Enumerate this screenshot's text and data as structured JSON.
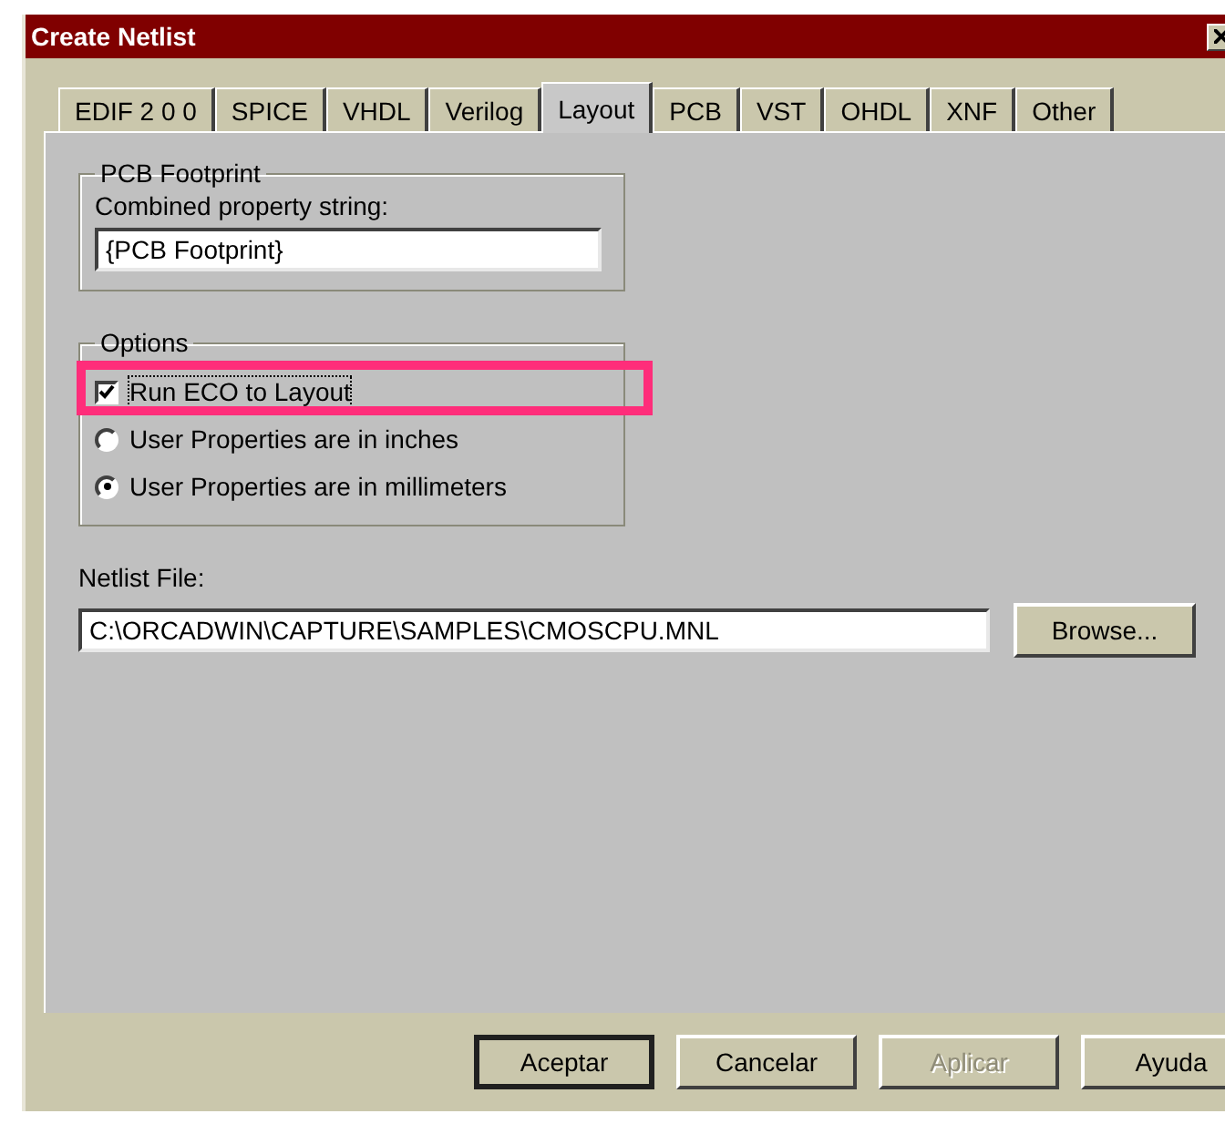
{
  "window": {
    "title": "Create Netlist"
  },
  "tabs": [
    {
      "label": "EDIF 2 0 0",
      "selected": false
    },
    {
      "label": "SPICE",
      "selected": false
    },
    {
      "label": "VHDL",
      "selected": false
    },
    {
      "label": "Verilog",
      "selected": false
    },
    {
      "label": "Layout",
      "selected": true
    },
    {
      "label": "PCB",
      "selected": false
    },
    {
      "label": "VST",
      "selected": false
    },
    {
      "label": "OHDL",
      "selected": false
    },
    {
      "label": "XNF",
      "selected": false
    },
    {
      "label": "Other",
      "selected": false
    }
  ],
  "pcb_footprint": {
    "legend": "PCB Footprint",
    "label": "Combined property string:",
    "value": "{PCB Footprint}"
  },
  "options": {
    "legend": "Options",
    "items": [
      {
        "kind": "checkbox",
        "label": "Run ECO to Layout",
        "checked": true,
        "highlighted": true
      },
      {
        "kind": "radio",
        "label": "User Properties are in inches",
        "selected": false,
        "highlighted": false
      },
      {
        "kind": "radio",
        "label": "User Properties are in millimeters",
        "selected": true,
        "highlighted": false
      }
    ]
  },
  "netlist_file": {
    "label": "Netlist File:",
    "value": "C:\\ORCADWIN\\CAPTURE\\SAMPLES\\CMOSCPU.MNL",
    "browse": "Browse..."
  },
  "buttons": [
    {
      "label": "Aceptar",
      "default": true,
      "disabled": false
    },
    {
      "label": "Cancelar",
      "default": false,
      "disabled": false
    },
    {
      "label": "Aplicar",
      "default": false,
      "disabled": true
    },
    {
      "label": "Ayuda",
      "default": false,
      "disabled": false
    }
  ]
}
